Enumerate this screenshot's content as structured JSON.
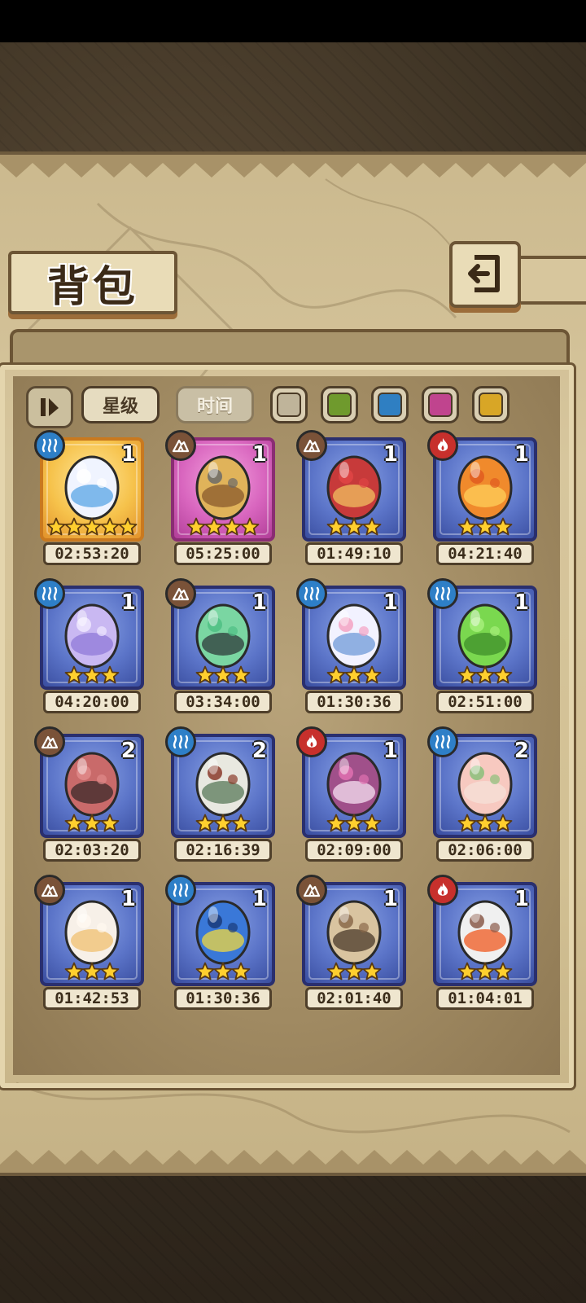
{
  "header": {
    "title": "背包"
  },
  "tabs": [
    {
      "label": "星级",
      "active": true
    },
    {
      "label": "时间",
      "active": false
    }
  ],
  "color_filters": [
    "#bfb49a",
    "#6f9a2d",
    "#2f7fc2",
    "#c0448e",
    "#d8a626"
  ],
  "colors": {
    "water": "#2e7fc7",
    "earth": "#7a5238",
    "fire": "#c7302c",
    "star": "#ffcf2e"
  },
  "eggs": [
    {
      "element": "water",
      "count": "1",
      "stars": 5,
      "time": "02:53:20",
      "frame": "gold",
      "icon": "heart-bow-egg-icon"
    },
    {
      "element": "earth",
      "count": "1",
      "stars": 4,
      "time": "05:25:00",
      "frame": "pink",
      "icon": "horned-furry-egg-icon"
    },
    {
      "element": "earth",
      "count": "1",
      "stars": 3,
      "time": "01:49:10",
      "frame": "blue",
      "icon": "helmet-crest-egg-icon"
    },
    {
      "element": "fire",
      "count": "1",
      "stars": 3,
      "time": "04:21:40",
      "frame": "blue",
      "icon": "flame-swirl-egg-icon"
    },
    {
      "element": "water",
      "count": "1",
      "stars": 3,
      "time": "04:20:00",
      "frame": "blue",
      "icon": "jellyfish-egg-icon"
    },
    {
      "element": "earth",
      "count": "1",
      "stars": 3,
      "time": "03:34:00",
      "frame": "blue",
      "icon": "armored-green-egg-icon"
    },
    {
      "element": "water",
      "count": "1",
      "stars": 3,
      "time": "01:30:36",
      "frame": "blue",
      "icon": "sailor-egg-icon"
    },
    {
      "element": "water",
      "count": "1",
      "stars": 3,
      "time": "02:51:00",
      "frame": "blue",
      "icon": "green-bubble-egg-icon"
    },
    {
      "element": "earth",
      "count": "2",
      "stars": 3,
      "time": "02:03:20",
      "frame": "blue",
      "icon": "cat-hood-egg-icon"
    },
    {
      "element": "water",
      "count": "2",
      "stars": 3,
      "time": "02:16:39",
      "frame": "blue",
      "icon": "cracked-stone-egg-icon"
    },
    {
      "element": "fire",
      "count": "1",
      "stars": 3,
      "time": "02:09:00",
      "frame": "blue",
      "icon": "mushroom-egg-icon"
    },
    {
      "element": "water",
      "count": "2",
      "stars": 3,
      "time": "02:06:00",
      "frame": "blue",
      "icon": "peach-egg-icon"
    },
    {
      "element": "earth",
      "count": "1",
      "stars": 3,
      "time": "01:42:53",
      "frame": "blue",
      "icon": "fluffy-winged-egg-icon"
    },
    {
      "element": "water",
      "count": "1",
      "stars": 3,
      "time": "01:30:36",
      "frame": "blue",
      "icon": "blue-eye-egg-icon"
    },
    {
      "element": "earth",
      "count": "1",
      "stars": 3,
      "time": "02:01:40",
      "frame": "blue",
      "icon": "straw-hat-egg-icon"
    },
    {
      "element": "fire",
      "count": "1",
      "stars": 3,
      "time": "01:04:01",
      "frame": "blue",
      "icon": "fire-horn-egg-icon"
    }
  ]
}
